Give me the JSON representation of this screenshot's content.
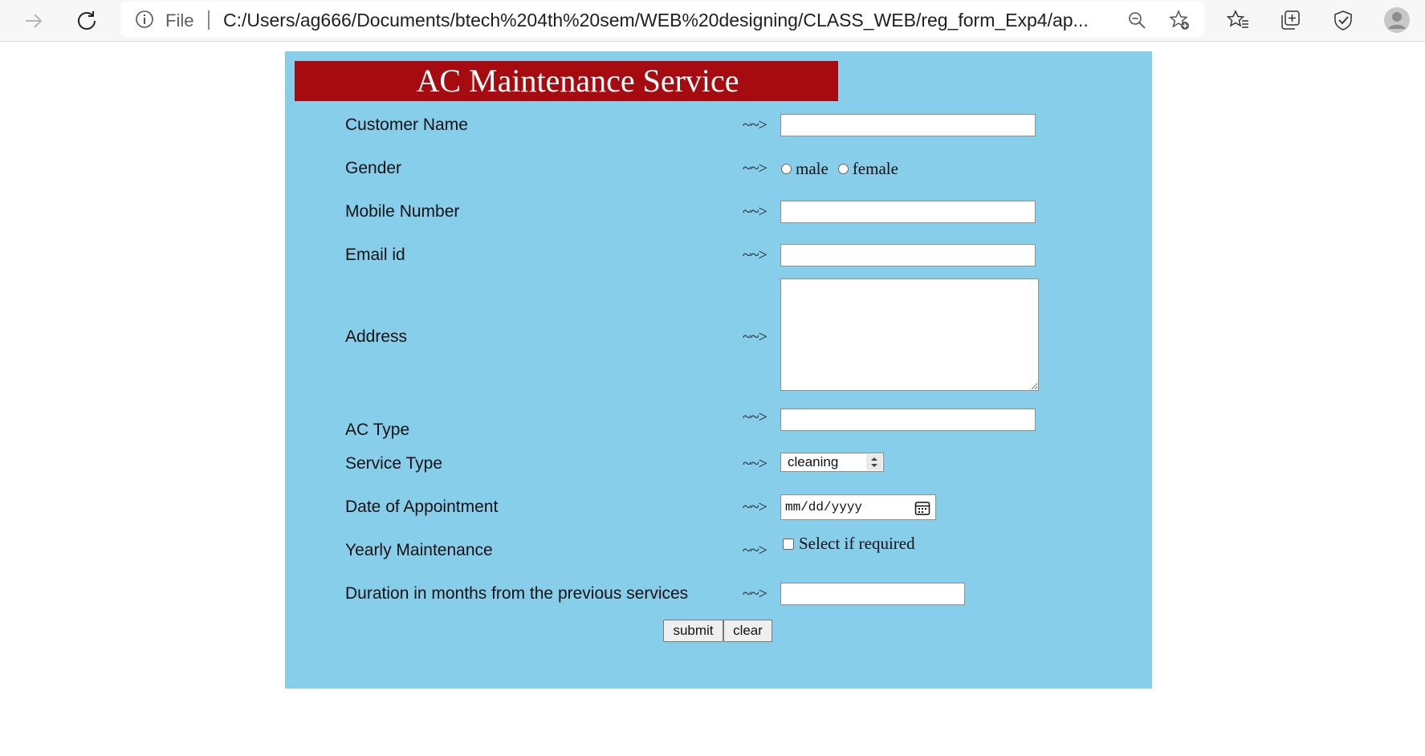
{
  "browser": {
    "address_scheme": "File",
    "url": "C:/Users/ag666/Documents/btech%204th%20sem/WEB%20designing/CLASS_WEB/reg_form_Exp4/ap..."
  },
  "form": {
    "title": "AC Maintenance Service",
    "arrow": "~~>",
    "labels": {
      "customer_name": "Customer Name",
      "gender": "Gender",
      "mobile": "Mobile Number",
      "email": "Email id",
      "address": "Address",
      "ac_type": "AC Type",
      "service_type": "Service Type",
      "date": "Date of Appointment",
      "yearly": "Yearly Maintenance",
      "duration": "Duration in months from the previous services"
    },
    "gender_options": [
      "male",
      "female"
    ],
    "service_type_value": "cleaning",
    "date_placeholder": "mm/dd/yyyy",
    "yearly_checkbox_label": "Select if required",
    "values": {
      "customer_name": "",
      "mobile": "",
      "email": "",
      "address": "",
      "ac_type": "",
      "duration": ""
    },
    "buttons": {
      "submit": "submit",
      "clear": "clear"
    }
  },
  "colors": {
    "panel_bg": "#87ceeb",
    "banner_bg": "#a50b0f",
    "banner_text": "#ffffff"
  }
}
